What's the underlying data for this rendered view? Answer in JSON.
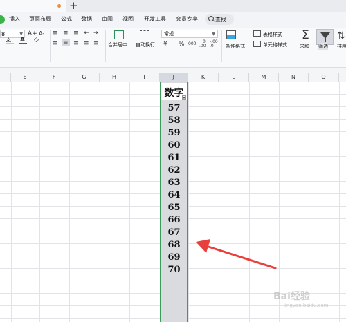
{
  "tabbar": {
    "new_tab_symbol": "+"
  },
  "menu": {
    "items": [
      "插入",
      "页面布局",
      "公式",
      "数据",
      "审阅",
      "视图",
      "开发工具",
      "会员专享"
    ],
    "search_label": "查找"
  },
  "ribbon": {
    "font_size": "8",
    "font_grow": "A+",
    "font_shrink": "A-",
    "merge_label": "合并居中",
    "wrap_label": "自动换行",
    "number_format": "常规",
    "currency_symbol": "¥",
    "percent_symbol": "%",
    "thousands_symbol": "000",
    "dec_inc": "+0 .00",
    "dec_dec": "-.00 .0",
    "conditional_format": "条件格式",
    "table_style": "表格样式",
    "cell_style": "单元格样式",
    "sum_label": "求和",
    "filter_label": "筛选",
    "sort_label": "排序"
  },
  "columns": [
    "E",
    "F",
    "G",
    "H",
    "I",
    "J",
    "K",
    "L",
    "M",
    "N",
    "O"
  ],
  "selected_column": "J",
  "sheet": {
    "header": "数字",
    "values": [
      "57",
      "58",
      "59",
      "60",
      "61",
      "62",
      "63",
      "64",
      "65",
      "66",
      "67",
      "68",
      "69",
      "70"
    ]
  },
  "watermark": {
    "text": "Bai经验",
    "url": "jingyan.baidu.com"
  },
  "colors": {
    "selection_border": "#3a9e5a",
    "arrow": "#e8403c",
    "accent_green": "#3cb34a"
  }
}
